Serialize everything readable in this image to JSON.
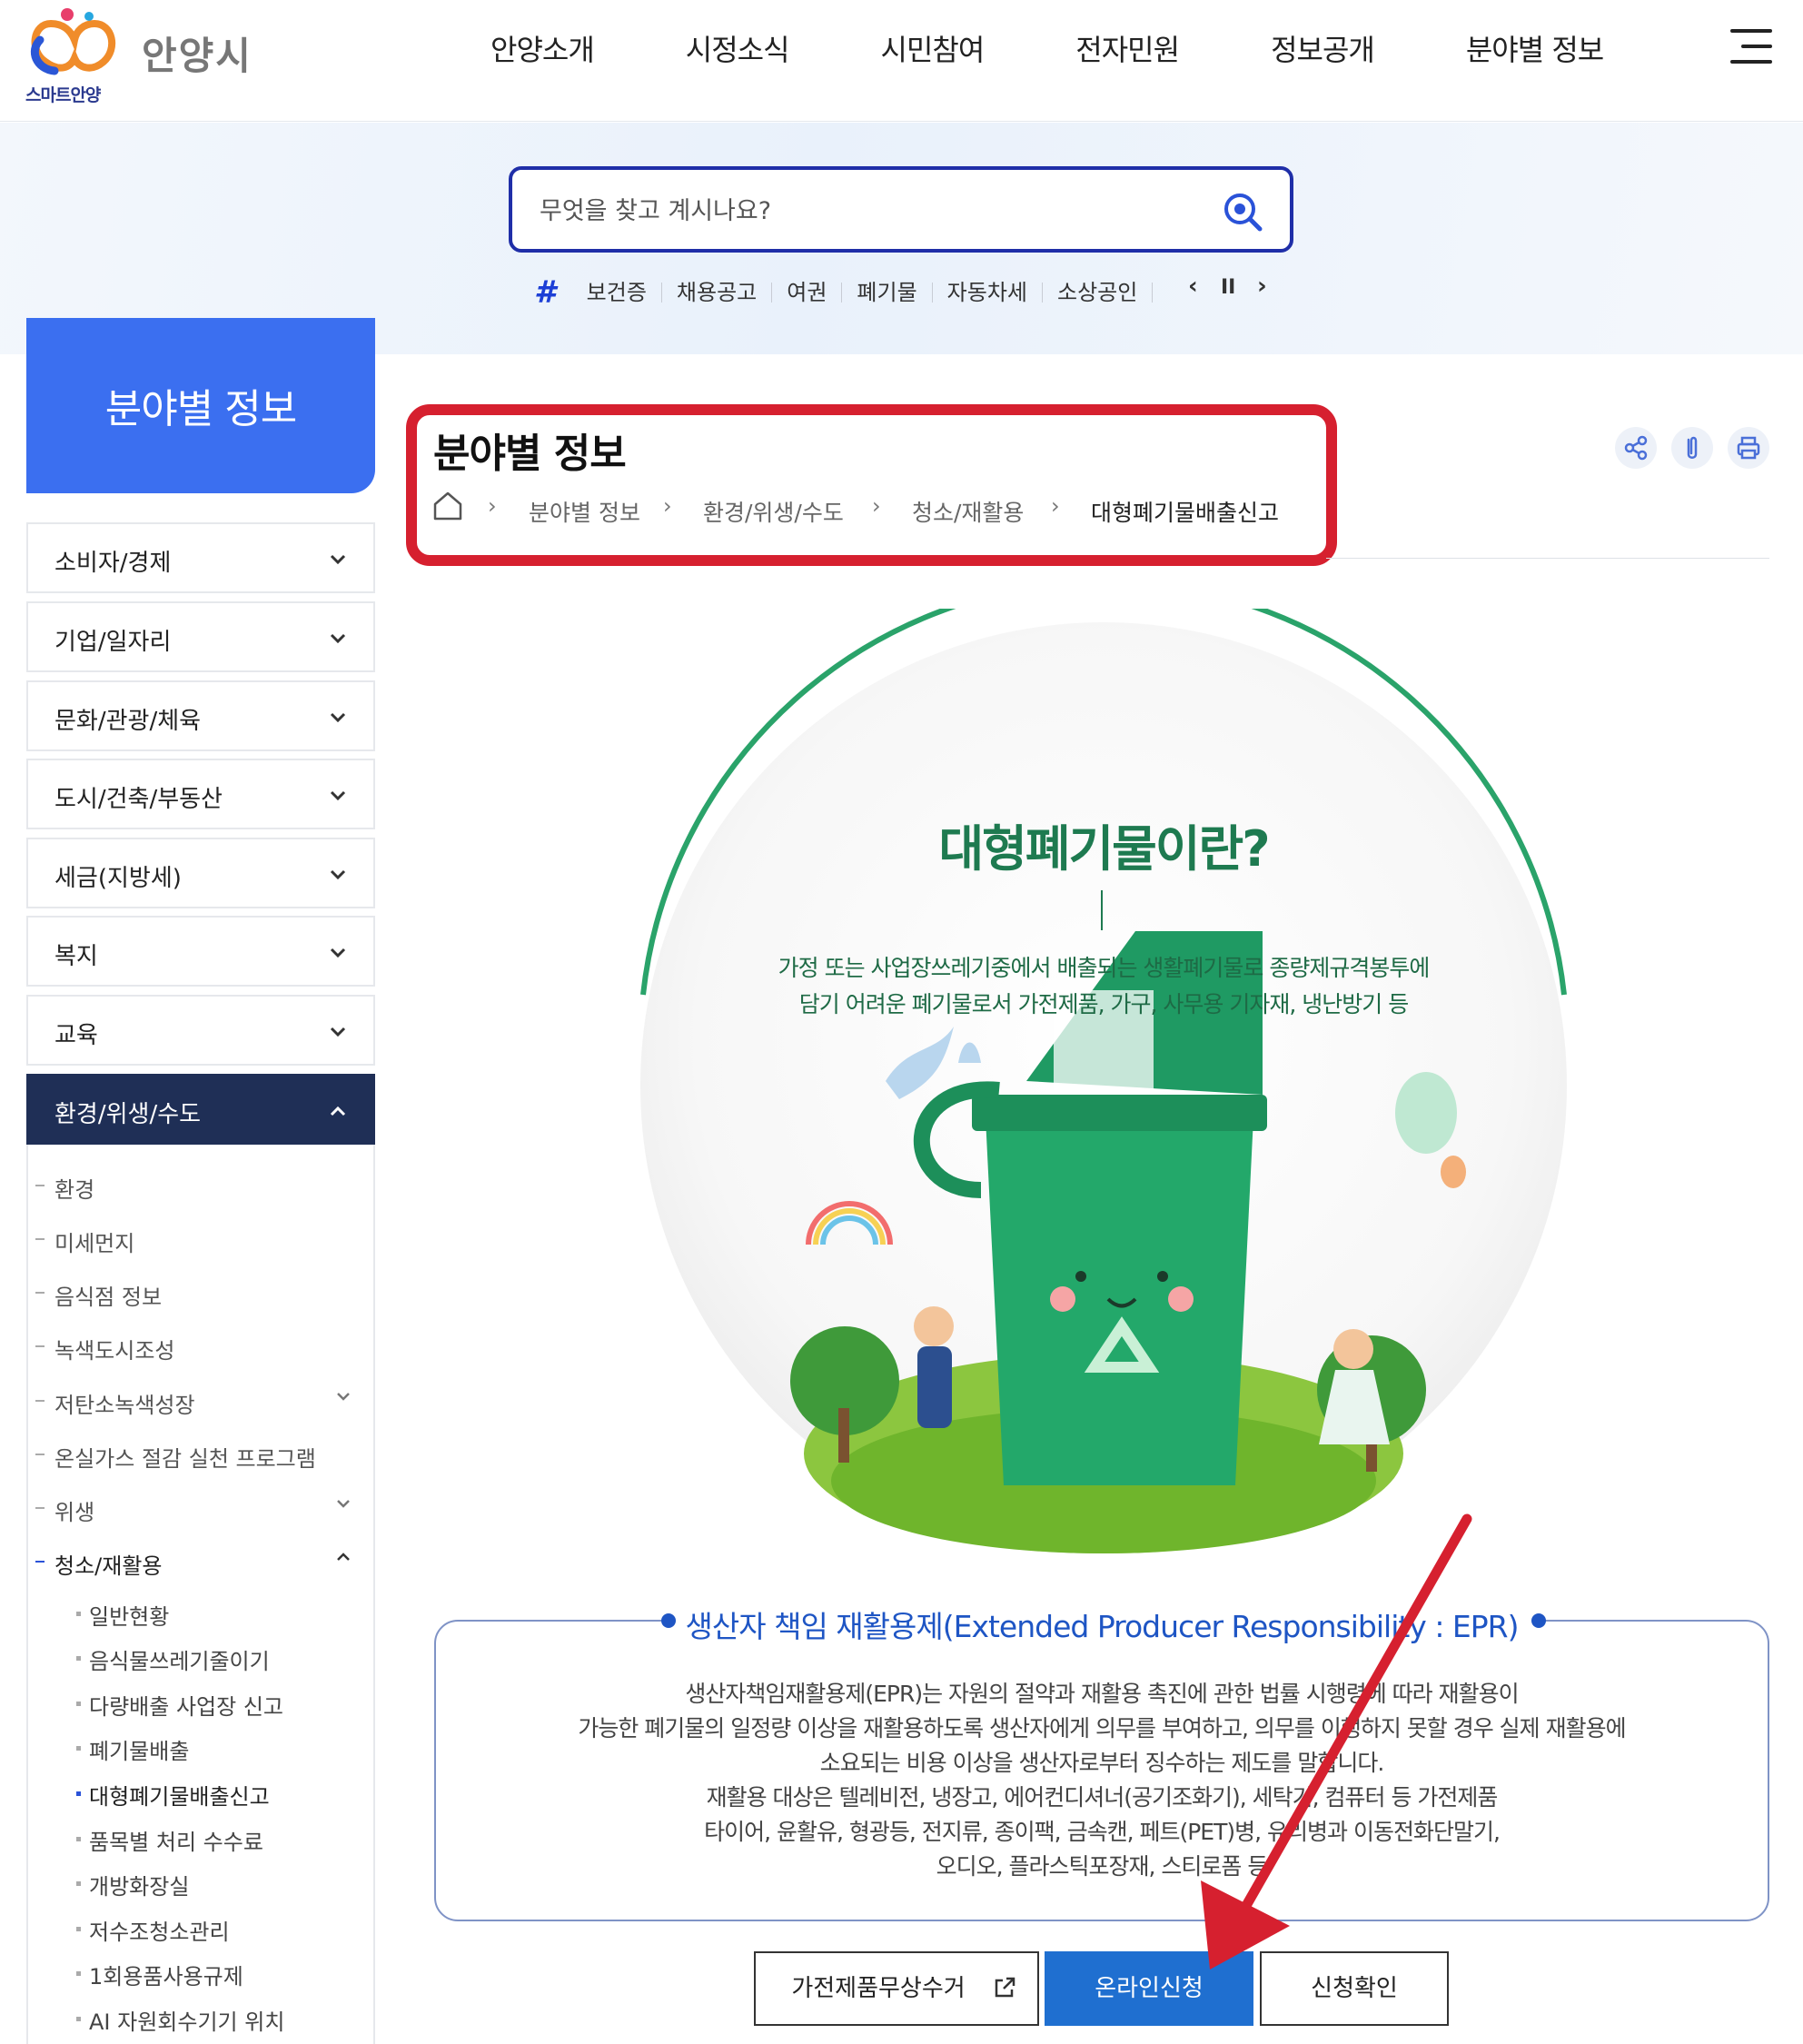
{
  "header": {
    "logo_sub": "스마트안양",
    "city_name": "안양시",
    "nav": [
      "안양소개",
      "시정소식",
      "시민참여",
      "전자민원",
      "정보공개",
      "분야별 정보"
    ],
    "menu_icon": "hamburger-menu-icon"
  },
  "search": {
    "placeholder": "무엇을 찾고 계시나요?",
    "tags": [
      "보건증",
      "채용공고",
      "여권",
      "폐기물",
      "자동차세",
      "소상공인"
    ],
    "controls": [
      "‹",
      "II",
      "›"
    ]
  },
  "sidebar": {
    "title": "분야별 정보",
    "items": [
      "소비자/경제",
      "기업/일자리",
      "문화/관광/체육",
      "도시/건축/부동산",
      "세금(지방세)",
      "복지",
      "교육",
      "환경/위생/수도"
    ],
    "sub_items": [
      "환경",
      "미세먼지",
      "음식점 정보",
      "녹색도시조성",
      "저탄소녹색성장",
      "온실가스 절감 실천 프로그램",
      "위생",
      "청소/재활용"
    ],
    "sub2_items": [
      "일반현황",
      "음식물쓰레기줄이기",
      "다량배출 사업장 신고",
      "폐기물배출",
      "대형폐기물배출신고",
      "품목별 처리 수수료",
      "개방화장실",
      "저수조청소관리",
      "1회용품사용규제",
      "AI 자원회수기기 위치"
    ]
  },
  "content": {
    "title": "분야별 정보",
    "breadcrumb": [
      "분야별 정보",
      "환경/위생/수도",
      "청소/재활용",
      "대형폐기물배출신고"
    ],
    "breadcrumb_sep": "›",
    "illus_title": "대형폐기물이란?",
    "illus_desc": [
      "가정 또는 사업장쓰레기중에서 배출되는 생활폐기물로 종량제규격봉투에",
      "담기 어려운 폐기물로서 가전제품, 가구, 사무용 기자재, 냉난방기 등"
    ],
    "epr_title": "생산자 책임 재활용제(Extended Producer Responsibility : EPR)",
    "epr_lines": [
      "생산자책임재활용제(EPR)는 자원의 절약과 재활용 촉진에 관한 법률 시행령에 따라 재활용이",
      "가능한 폐기물의 일정량 이상을 재활용하도록 생산자에게 의무를 부여하고, 의무를 이행하지 못할 경우 실제 재활용에",
      "소요되는 비용 이상을 생산자로부터 징수하는 제도를 말합니다.",
      "재활용 대상은 텔레비전, 냉장고, 에어컨디셔너(공기조화기), 세탁기, 컴퓨터 등 가전제품",
      "타이어, 윤활유, 형광등, 전지류, 종이팩, 금속캔, 페트(PET)병, 유리병과 이동전화단말기,",
      "오디오, 플라스틱포장재, 스티로폼 등"
    ],
    "buttons": {
      "free_pickup": "가전제품무상수거",
      "online": "온라인신청",
      "check": "신청확인"
    }
  },
  "colors": {
    "primary_blue": "#3b6ff0",
    "navy": "#1f2f56",
    "highlight_red": "#d6202f",
    "green": "#1e7a50",
    "button_blue": "#1f6fd0"
  }
}
